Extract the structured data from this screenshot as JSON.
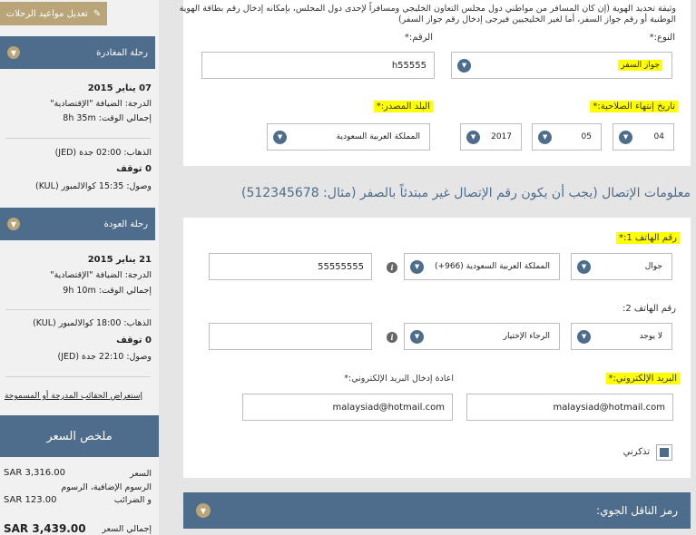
{
  "sidebar": {
    "edit_label": "تعديل مواعيد الرحلات",
    "departure": {
      "header": "رحلة المغادرة",
      "date": "07 يناير 2015",
      "class": "الدرجة: الضيافة \"الإقتصادية\"",
      "total": "إجمالي الوقت: 8h 35m",
      "depart": "الذهاب: 02:00 جدة (JED)",
      "stops": "0 توقف",
      "arrive": "وصول: 15:35 كوالالمبور (KUL)"
    },
    "return": {
      "header": "رحلة العودة",
      "date": "21 يناير 2015",
      "class": "الدرجة: الضيافة \"الإقتصادية\"",
      "total": "إجمالي الوقت: 9h 10m",
      "depart": "الذهاب: 18:00 كوالالمبور (KUL)",
      "stops": "0 توقف",
      "arrive": "وصول: 22:10 جدة (JED)"
    },
    "baggage_link": "إستعراض الحقائب المدرجة أو المسموحة",
    "price": {
      "header": "ملخص السعر",
      "fare_label": "السعر",
      "fare_value": "SAR 3,316.00",
      "fees_label_1": "الرسوم الإضافية، الرسوم",
      "fees_label_2": "و الضرائب",
      "fees_value": "SAR 123.00",
      "total_label": "إجمالي السعر",
      "total_value": "SAR 3,439.00"
    }
  },
  "identity": {
    "note_1": "وثيقة تحديد الهوية (إن كان المسافر من مواطني دول مجلس التعاون الخليجي ومسافراً لإحدى دول المجلس، بإمكانه إدخال رقم بطاقة الهوية",
    "note_2": "الوطنية أو رقم جواز السفر، أما لغير الخليجيين فيرجى إدخال رقم جواز السفر)",
    "type_label": "النوع:*",
    "type_value": "جواز السفر",
    "number_label": "الرقم:*",
    "number_value": "h55555",
    "expiry_label": "تاريخ إنتهاء الصلاحية:*",
    "expiry_day": "04",
    "expiry_month": "05",
    "expiry_year": "2017",
    "country_label": "البلد المصدر:*",
    "country_value": "المملكة العربية السعودية"
  },
  "contact": {
    "title": "معلومات الإتصال (يجب أن يكون رقم الإتصال غير مبتدئاً بالصفر (مثال: 512345678)",
    "phone1_label": "رقم الهاتف 1:*",
    "phone1_type": "جوال",
    "phone1_country": "المملكة العربية السعودية (966+)",
    "phone1_number": "55555555",
    "phone2_label": "رقم الهاتف 2:",
    "phone2_type": "لا يوجد",
    "phone2_country": "الرجاء الإختيار",
    "phone2_number": "",
    "email_label": "البريد الإلكتروني:*",
    "email_value": "malaysiad@hotmail.com",
    "email_confirm_label": "اعادة إدخال البريد الإلكتروني:*",
    "email_confirm_value": "malaysiad@hotmail.com",
    "remember_label": "تذكرني"
  },
  "cargo": {
    "title": "رمز الناقل الجوي:"
  }
}
